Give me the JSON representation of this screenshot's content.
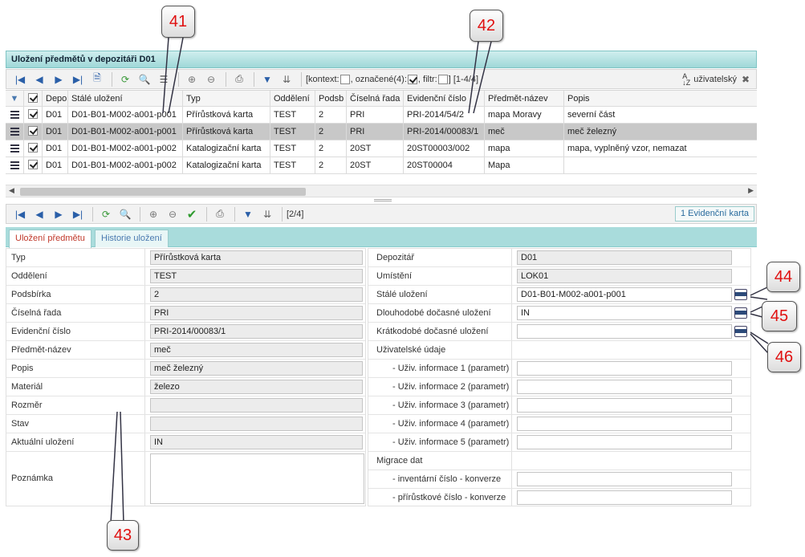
{
  "window": {
    "title": "Uložení předmětů v depozitáři D01"
  },
  "top_toolbar": {
    "icons": [
      "first-icon",
      "prev-icon",
      "next-icon",
      "last-icon",
      "export-icon",
      "refresh-icon",
      "search-icon",
      "columns-icon",
      "add-icon",
      "remove-icon",
      "print-icon",
      "filter-icon",
      "filter-clear-icon"
    ],
    "status": {
      "kontext_label": "[kontext:",
      "oznacene_label": ", označené(4):",
      "filtr_label": ", filtr:",
      "range": "] [1-4/4]"
    },
    "sort_label": "uživatelský"
  },
  "grid": {
    "columns": [
      "Depo",
      "Stálé uložení",
      "Typ",
      "Oddělení",
      "Podsb",
      "Číselná řada",
      "Evidenční číslo",
      "Předmět-název",
      "Popis"
    ],
    "rows": [
      {
        "depo": "D01",
        "stale": "D01-B01-M002-a001-p001",
        "typ": "Přírůstková karta",
        "oddeleni": "TEST",
        "podsb": "2",
        "rada": "PRI",
        "ev": "PRI-2014/54/2",
        "nazev": "mapa Moravy",
        "popis": "severní část"
      },
      {
        "depo": "D01",
        "stale": "D01-B01-M002-a001-p001",
        "typ": "Přírůstková karta",
        "oddeleni": "TEST",
        "podsb": "2",
        "rada": "PRI",
        "ev": "PRI-2014/00083/1",
        "nazev": "meč",
        "popis": "meč železný"
      },
      {
        "depo": "D01",
        "stale": "D01-B01-M002-a001-p002",
        "typ": "Katalogizační karta",
        "oddeleni": "TEST",
        "podsb": "2",
        "rada": "20ST",
        "ev": "20ST00003/002",
        "nazev": "mapa",
        "popis": "mapa, vyplněný vzor, nemazat"
      },
      {
        "depo": "D01",
        "stale": "D01-B01-M002-a001-p002",
        "typ": "Katalogizační karta",
        "oddeleni": "TEST",
        "podsb": "2",
        "rada": "20ST",
        "ev": "20ST00004",
        "nazev": "Mapa",
        "popis": ""
      }
    ],
    "selected_row": 1
  },
  "bottom_toolbar": {
    "position": "[2/4]",
    "counter_button": "1 Evidenční karta"
  },
  "tabs": [
    {
      "label": "Uložení předmětu",
      "active": true
    },
    {
      "label": "Historie uložení",
      "active": false
    }
  ],
  "form_left": [
    {
      "label": "Typ",
      "value": "Přírůstková karta"
    },
    {
      "label": "Oddělení",
      "value": "TEST"
    },
    {
      "label": "Podsbírka",
      "value": "2"
    },
    {
      "label": "Číselná řada",
      "value": "PRI"
    },
    {
      "label": "Evidenční číslo",
      "value": "PRI-2014/00083/1"
    },
    {
      "label": "Předmět-název",
      "value": "meč"
    },
    {
      "label": "Popis",
      "value": "meč železný"
    },
    {
      "label": "Materiál",
      "value": "železo"
    },
    {
      "label": "Rozměr",
      "value": ""
    },
    {
      "label": "Stav",
      "value": ""
    },
    {
      "label": "Aktuální uložení",
      "value": "IN"
    },
    {
      "label": "Poznámka",
      "value": ""
    }
  ],
  "form_right": [
    {
      "label": "Depozitář",
      "value": "D01"
    },
    {
      "label": "Umístění",
      "value": "LOK01"
    },
    {
      "label": "Stálé uložení",
      "value": "D01-B01-M002-a001-p001"
    },
    {
      "label": "Dlouhodobé dočasné uložení",
      "value": "IN"
    },
    {
      "label": "Krátkodobé dočasné uložení",
      "value": ""
    },
    {
      "label": "Uživatelské údaje",
      "value": null
    },
    {
      "label": "- Uživ. informace 1 (parametr)",
      "value": ""
    },
    {
      "label": "- Uživ. informace 2 (parametr)",
      "value": ""
    },
    {
      "label": "- Uživ. informace 3 (parametr)",
      "value": ""
    },
    {
      "label": "- Uživ. informace 4 (parametr)",
      "value": ""
    },
    {
      "label": "- Uživ. informace 5 (parametr)",
      "value": ""
    },
    {
      "label": "Migrace dat",
      "value": null
    },
    {
      "label": "- inventární číslo - konverze",
      "value": ""
    },
    {
      "label": "- přírůstkové číslo - konverze",
      "value": ""
    }
  ],
  "callouts": [
    "41",
    "42",
    "43",
    "44",
    "45",
    "46"
  ],
  "colors": {
    "header_teal": "#9fd8d8",
    "callout_text": "#e01010",
    "active_tab_text": "#c0392b"
  }
}
